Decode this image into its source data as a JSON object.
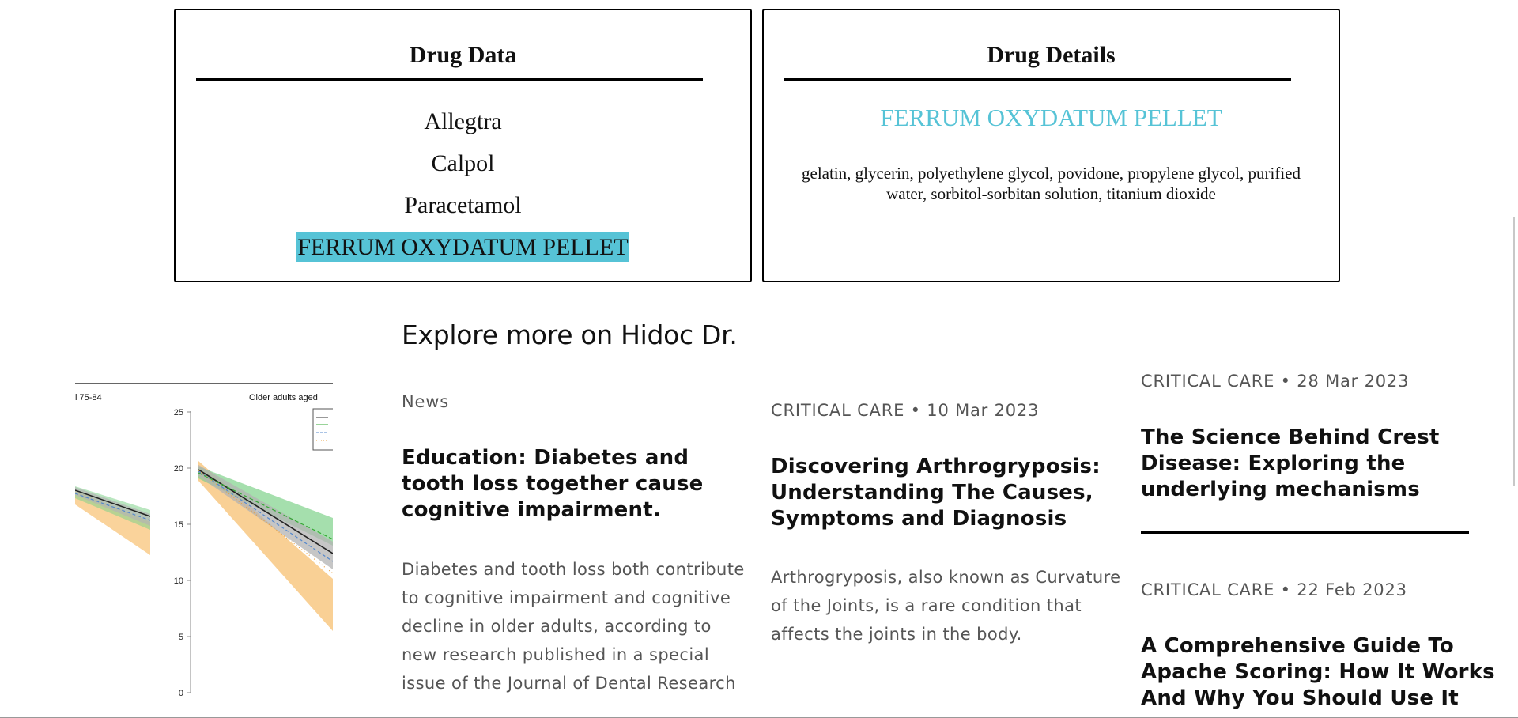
{
  "drug_data": {
    "heading": "Drug Data",
    "drugs": [
      "Allegtra",
      "Calpol",
      "Paracetamol",
      "FERRUM OXYDATUM PELLET"
    ],
    "selected": "FERRUM OXYDATUM PELLET"
  },
  "drug_details": {
    "heading": "Drug Details",
    "name": "FERRUM OXYDATUM PELLET",
    "ingredients": "gelatin, glycerin, polyethylene glycol, povidone, propylene glycol, purified water, sorbitol-sorbitan solution, titanium dioxide"
  },
  "explore": {
    "title": "Explore more on Hidoc Dr.",
    "image": {
      "left_label": "l 75-84",
      "right_label": "Older adults aged",
      "y_ticks": [
        "25",
        "20",
        "15",
        "10",
        "5",
        "0"
      ]
    },
    "articles": [
      {
        "meta": "News",
        "title": "Education: Diabetes and tooth loss together cause cognitive impairment.",
        "excerpt": "Diabetes and tooth loss both contribute to cognitive impairment and cognitive decline in older adults, according to new research published in a special issue of the Journal of Dental Research"
      },
      {
        "meta": "CRITICAL CARE • 10 Mar 2023",
        "title": "Discovering Arthrogryposis: Understanding The Causes, Symptoms and Diagnosis",
        "excerpt": "Arthrogryposis, also known as Curvature of the Joints, is a rare condition that affects the joints in the body."
      },
      {
        "meta": "CRITICAL CARE • 28 Mar 2023",
        "title": "The Science Behind Crest Disease: Exploring the underlying mechanisms"
      },
      {
        "meta": "CRITICAL CARE • 22 Feb 2023",
        "title": "A Comprehensive Guide To Apache Scoring: How It Works And Why You Should Use It"
      }
    ]
  },
  "colors": {
    "accent": "#56c3d6",
    "text": "#111111",
    "muted": "#555555"
  }
}
